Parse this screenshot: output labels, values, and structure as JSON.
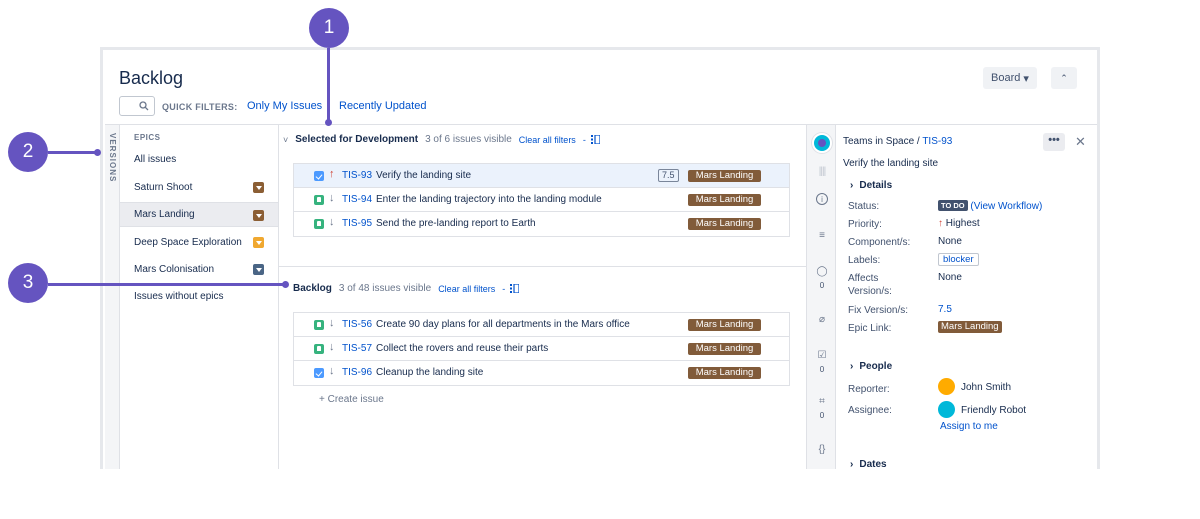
{
  "header": {
    "title": "Backlog",
    "board_label": "Board",
    "quick_filters_label": "QUICK FILTERS:",
    "quick_filters": [
      "Only My Issues",
      "Recently Updated"
    ]
  },
  "versions_label": "VERSIONS",
  "epics": {
    "heading": "EPICS",
    "items": [
      {
        "label": "All issues",
        "color": ""
      },
      {
        "label": "Saturn Shoot",
        "color": "#8b5e34"
      },
      {
        "label": "Mars Landing",
        "color": "#8b5e34"
      },
      {
        "label": "Deep Space Exploration",
        "color": "#f0a830"
      },
      {
        "label": "Mars Colonisation",
        "color": "#4a6585"
      },
      {
        "label": "Issues without epics",
        "color": ""
      }
    ]
  },
  "sprint": {
    "title": "Selected for Development",
    "visible": "3 of 6 issues visible",
    "clear_filters": "Clear all filters",
    "issues": [
      {
        "type": "task",
        "priority": "high",
        "key": "TIS-93",
        "summary": "Verify the landing site",
        "estimate": "7.5",
        "epic": "Mars Landing"
      },
      {
        "type": "story",
        "priority": "low",
        "key": "TIS-94",
        "summary": "Enter the landing trajectory into the landing module",
        "estimate": "",
        "epic": "Mars Landing"
      },
      {
        "type": "story",
        "priority": "low",
        "key": "TIS-95",
        "summary": "Send the pre-landing report to Earth",
        "estimate": "",
        "epic": "Mars Landing"
      }
    ]
  },
  "backlog": {
    "title": "Backlog",
    "visible": "3 of 48 issues visible",
    "clear_filters": "Clear all filters",
    "issues": [
      {
        "type": "story",
        "priority": "low",
        "key": "TIS-56",
        "summary": "Create 90 day plans for all departments in the Mars office",
        "epic": "Mars Landing"
      },
      {
        "type": "story",
        "priority": "low",
        "key": "TIS-57",
        "summary": "Collect the rovers and reuse their parts",
        "epic": "Mars Landing"
      },
      {
        "type": "task",
        "priority": "low",
        "key": "TIS-96",
        "summary": "Cleanup the landing site",
        "epic": "Mars Landing"
      }
    ],
    "create_issue": "+   Create issue"
  },
  "side_strip": {
    "comments_count": "0",
    "subtasks_count": "0",
    "tests_count": "0"
  },
  "detail": {
    "project": "Teams in Space",
    "separator": " / ",
    "key": "TIS-93",
    "summary": "Verify the landing site",
    "details_heading": "Details",
    "fields": {
      "status_label": "Status:",
      "status_value": "TO DO",
      "status_link": "(View Workflow)",
      "priority_label": "Priority:",
      "priority_value": "Highest",
      "component_label": "Component/s:",
      "component_value": "None",
      "labels_label": "Labels:",
      "labels_value": "blocker",
      "affects_label": "Affects Version/s:",
      "affects_value": "None",
      "fix_label": "Fix Version/s:",
      "fix_value": "7.5",
      "epic_label": "Epic Link:",
      "epic_value": "Mars Landing"
    },
    "people_heading": "People",
    "reporter_label": "Reporter:",
    "reporter": "John Smith",
    "assignee_label": "Assignee:",
    "assignee": "Friendly Robot",
    "assign_to_me": "Assign to me",
    "dates_heading": "Dates"
  },
  "callouts": [
    "1",
    "2",
    "3"
  ],
  "colors": {
    "accent": "#0052cc",
    "callout": "#6554c0",
    "epic_lozenge": "#815b3a"
  }
}
